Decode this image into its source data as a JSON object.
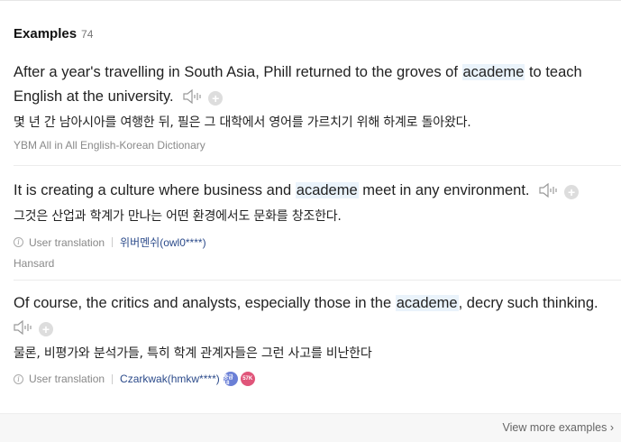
{
  "header": {
    "title": "Examples",
    "count": "74"
  },
  "examples": [
    {
      "pre": "After a year's travelling in South Asia, Phill returned to the groves of ",
      "keyword": "academe",
      "post": " to teach English at the university.",
      "translation": "몇 년 간 남아시아를 여행한 뒤, 필은 그 대학에서 영어를 가르치기 위해 하계로 돌아왔다.",
      "source": "YBM All in All English-Korean Dictionary"
    },
    {
      "pre": "It is creating a culture where business and ",
      "keyword": "academe",
      "post": " meet in any environment.",
      "translation": "그것은 산업과 학계가 만나는 어떤 환경에서도 문화를 창조한다.",
      "meta_label": "User translation",
      "user": "위버멘쉬(owl0****)",
      "source": "Hansard"
    },
    {
      "pre": "Of course, the critics and analysts, especially those in the ",
      "keyword": "academe",
      "post": ", decry such thinking.",
      "translation": "물론, 비평가와 분석가들, 특히 학계 관계자들은 그런 사고를 비난한다",
      "meta_label": "User translation",
      "user": "Czarkwak(hmkw****)",
      "badge1": "중급 18",
      "badge2": "57K"
    }
  ],
  "footer": {
    "more_label": "View more examples"
  },
  "icons": {
    "info": "i",
    "plus": "+"
  }
}
